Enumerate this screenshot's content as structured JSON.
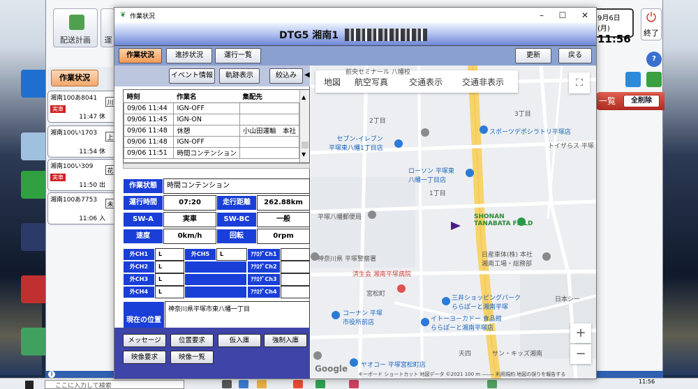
{
  "background_app": {
    "toolbar_plan": "配送計画",
    "toolbar_partial": "運",
    "date": "9月6日(月)",
    "clock": "11:56",
    "exit": "終了",
    "tab_status": "作業状況",
    "list_header": "一覧",
    "clear_all": "全削除",
    "vehicles": [
      {
        "name": "湘南100あ8041",
        "tag": "実車",
        "time": "11:47 休",
        "box": "川"
      },
      {
        "name": "湘南100い1703",
        "tag": "",
        "time": "11:54 休",
        "box": "上"
      },
      {
        "name": "湘南100い309",
        "tag": "実車",
        "time": "11:50 出",
        "box": "花"
      },
      {
        "name": "湘南100あ7753",
        "tag": "",
        "time": "11:06 入",
        "box": "未"
      }
    ]
  },
  "window": {
    "title": "作業状況",
    "vehicle_title": "DTG5 湘南1",
    "controls": {
      "minimize": "–",
      "maximize": "☐",
      "close": "✕"
    }
  },
  "nav": {
    "tabs": [
      "作業状況",
      "進捗状況",
      "運行一覧"
    ],
    "update": "更新",
    "back": "戻る"
  },
  "subbar": {
    "event_info": "イベント情報",
    "track_display": "軌跡表示",
    "filter": "絞込み"
  },
  "events": {
    "columns": [
      "時刻",
      "作業名",
      "集配先"
    ],
    "rows": [
      [
        "09/06 11:44",
        "IGN-OFF",
        ""
      ],
      [
        "09/06 11:45",
        "IGN-ON",
        ""
      ],
      [
        "09/06 11:48",
        "休憩",
        "小山田運輸　本社"
      ],
      [
        "09/06 11:48",
        "IGN-OFF",
        ""
      ],
      [
        "09/06 11:51",
        "時間コンテンション",
        ""
      ]
    ]
  },
  "status": {
    "work_status_label": "作業状態",
    "work_status": "時間コンテンション",
    "run_time_label": "運行時間",
    "run_time": "07:20",
    "distance_label": "走行距離",
    "distance": "262.88km",
    "swa_label": "SW-A",
    "swa": "実車",
    "swbc_label": "SW-BC",
    "swbc": "一般",
    "speed_label": "速度",
    "speed": "0km/h",
    "rpm_label": "回転",
    "rpm": "0rpm"
  },
  "channels": {
    "rows": [
      {
        "ext": "外CH1",
        "ext_val": "L",
        "ext2": "外CH5",
        "ext2_val": "L",
        "analog": "ｱﾅﾛｸﾞCh1"
      },
      {
        "ext": "外CH2",
        "ext_val": "L",
        "ext2": "",
        "ext2_val": "",
        "analog": "ｱﾅﾛｸﾞCh2"
      },
      {
        "ext": "外CH3",
        "ext_val": "L",
        "ext2": "",
        "ext2_val": "",
        "analog": "ｱﾅﾛｸﾞCh3"
      },
      {
        "ext": "外CH4",
        "ext_val": "L",
        "ext2": "",
        "ext2_val": "",
        "analog": "ｱﾅﾛｸﾞCh4"
      }
    ]
  },
  "location": {
    "label": "現在の位置",
    "address": "神奈川県平塚市東八幡一丁目"
  },
  "bottom_buttons": {
    "message": "メッセージ",
    "location_request": "位置要求",
    "temp_store": "仮入庫",
    "force_store": "強制入庫",
    "video_request": "映像要求",
    "video_list": "映像一覧"
  },
  "map": {
    "tabs": [
      "地図",
      "航空写真",
      "交通表示",
      "交通非表示"
    ],
    "zoom_in": "+",
    "zoom_out": "−",
    "fullscreen": "⛶",
    "labels": {
      "seminar": "前央セミナール 八幡校",
      "chome2": "2丁目",
      "chome3": "3丁目",
      "chome1": "1丁目",
      "seven": "セブン-イレブン\n平塚東八幡1丁目店",
      "sports": "スポーツデポシラトリ平塚店",
      "toys": "トイザらス 平塚",
      "lawson": "ローソン 平塚東\n八幡一丁目店",
      "post": "平塚八幡郵便局",
      "shonan": "SHONAN\nTANABATA FIELD",
      "police": "神奈川県 平塚警察署",
      "nissan": "日産車体(株) 本社\n湘南工場・総務部",
      "hospital": "済生会 湘南平塚病院",
      "miyamatsu": "宮松町",
      "mitsui": "三井ショッピングパーク\nららぽーと湘南平塚",
      "konan": "コーナン 平塚\n市役所前店",
      "itoyokado": "イトーヨーカドー 食品館\nららぽーと湘南平塚店",
      "tenma": "天四",
      "sun_kids": "サン・キッズ湘南",
      "yaoko": "ヤオコー 平塚宮松町店",
      "japan_i": "日本シー"
    },
    "google": "Google",
    "attribution": "キーボード ショートカット   地図データ ©2021   100 m  ⎯⎯⎯⎯⎯   利用規約   地図の誤りを報告する"
  },
  "taskbar": {
    "search": "ここに入力して検索",
    "clock": "11:56"
  },
  "colors": {
    "label_blue": "#1a3fd8",
    "active_tab": "#f29a56",
    "bottom_bar": "#3e44a8",
    "nav_bar": "#8aa0cf",
    "road_yellow": "#f7d36b",
    "vehicle_marker": "#4a1a8a"
  }
}
